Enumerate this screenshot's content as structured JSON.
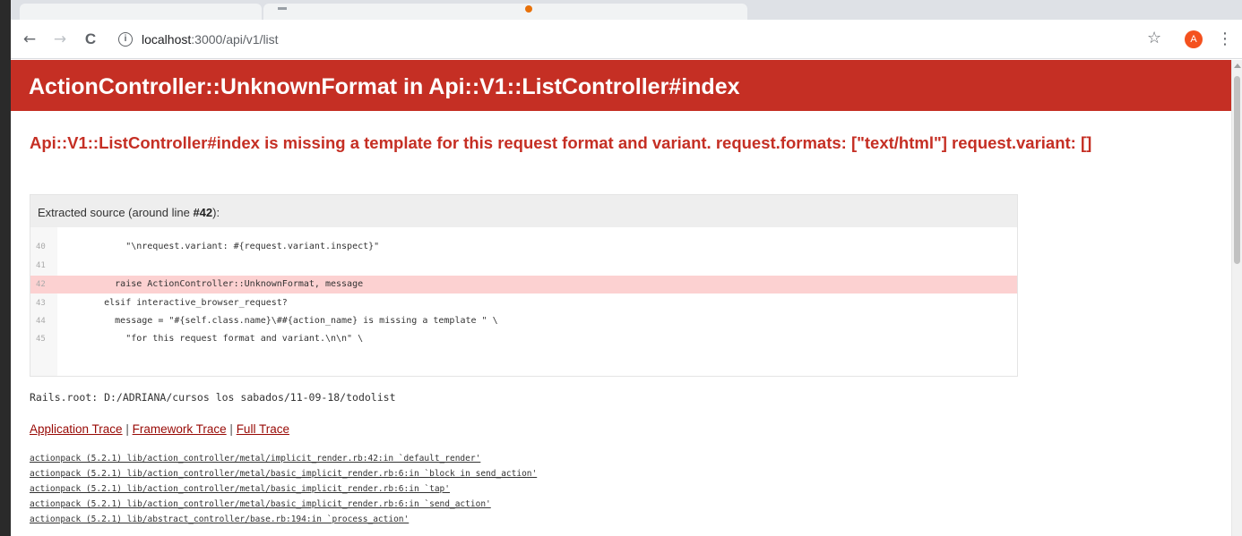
{
  "browser": {
    "url_host": "localhost",
    "url_path": ":3000/api/v1/list",
    "info_glyph": "i",
    "back_glyph": "←",
    "forward_glyph": "→",
    "reload_glyph": "C",
    "star_glyph": "☆",
    "avatar_letter": "A",
    "menu_glyph": "⋮",
    "accent_color": "#f4511e"
  },
  "page": {
    "title": "ActionController::UnknownFormat in Api::V1::ListController#index",
    "error_message": "Api::V1::ListController#index is missing a template for this request format and variant. request.formats: [\"text/html\"] request.variant: []",
    "header_color": "#c52f24",
    "source": {
      "heading_prefix": "Extracted source (around line ",
      "heading_line": "#42",
      "heading_suffix": "):",
      "lines": [
        {
          "no": "40",
          "code": "          \"\\nrequest.variant: #{request.variant.inspect}\"",
          "highlight": false
        },
        {
          "no": "41",
          "code": "",
          "highlight": false
        },
        {
          "no": "42",
          "code": "        raise ActionController::UnknownFormat, message",
          "highlight": true
        },
        {
          "no": "43",
          "code": "      elsif interactive_browser_request?",
          "highlight": false
        },
        {
          "no": "44",
          "code": "        message = \"#{self.class.name}\\##{action_name} is missing a template \" \\",
          "highlight": false
        },
        {
          "no": "45",
          "code": "          \"for this request format and variant.\\n\\n\" \\",
          "highlight": false
        }
      ]
    },
    "rails_root": "Rails.root: D:/ADRIANA/cursos los sabados/11-09-18/todolist",
    "trace_links": {
      "application": "Application Trace",
      "framework": "Framework Trace",
      "full": "Full Trace",
      "separator": "|"
    },
    "trace": [
      "actionpack (5.2.1) lib/action_controller/metal/implicit_render.rb:42:in `default_render'",
      "actionpack (5.2.1) lib/action_controller/metal/basic_implicit_render.rb:6:in `block in send_action'",
      "actionpack (5.2.1) lib/action_controller/metal/basic_implicit_render.rb:6:in `tap'",
      "actionpack (5.2.1) lib/action_controller/metal/basic_implicit_render.rb:6:in `send_action'",
      "actionpack (5.2.1) lib/abstract_controller/base.rb:194:in `process_action'"
    ]
  }
}
